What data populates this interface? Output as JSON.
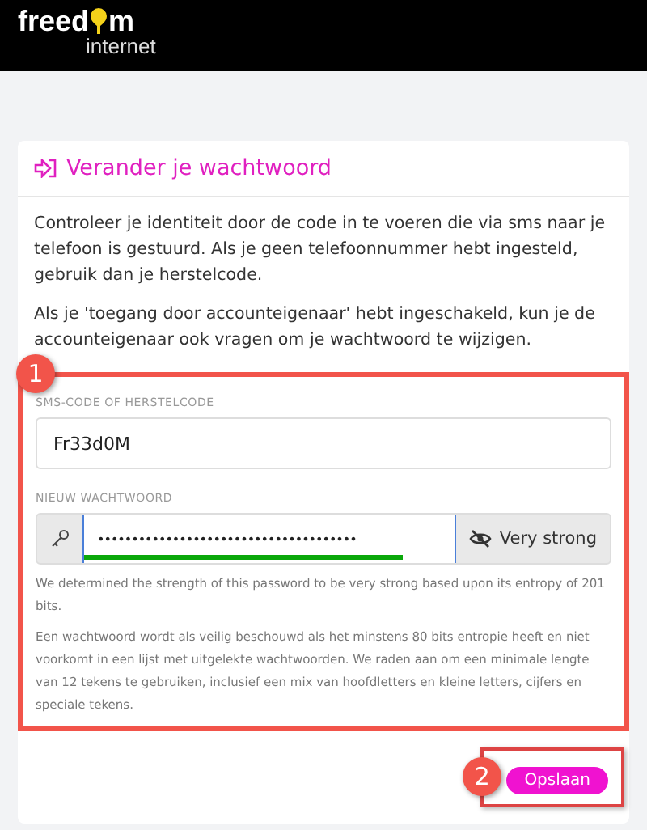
{
  "logo": {
    "before": "freed",
    "after": "m",
    "tagline": "internet"
  },
  "card": {
    "title": "Verander je wachtwoord",
    "paragraphs": [
      "Controleer je identiteit door de code in te voeren die via sms naar je telefoon is gestuurd. Als je geen telefoonnummer hebt ingesteld, gebruik dan je herstelcode.",
      "Als je 'toegang door accounteigenaar' hebt ingeschakeld, kun je de accounteigenaar ook vragen om je wachtwoord te wijzigen."
    ],
    "code_field": {
      "label": "SMS-CODE OF HERSTELCODE",
      "value": "Fr33d0M"
    },
    "password_field": {
      "label": "NIEUW WACHTWOORD",
      "value": "••••••••••••••••••••••••••••••••••••••",
      "strength": "Very strong",
      "level": 0.86
    },
    "strength_note": "We determined the strength of this password to be very strong based upon its entropy of 201 bits.",
    "advice": "Een wachtwoord wordt als veilig beschouwd als het minstens 80 bits entropie heeft en niet voorkomt in een lijst met uitgelekte wachtwoorden. We raden aan om een minimale lengte van 12 tekens te gebruiken, inclusief een mix van hoofdletters en kleine letters, cijfers en speciale tekens.",
    "save_button": "Opslaan"
  },
  "callouts": [
    "1",
    "2"
  ]
}
